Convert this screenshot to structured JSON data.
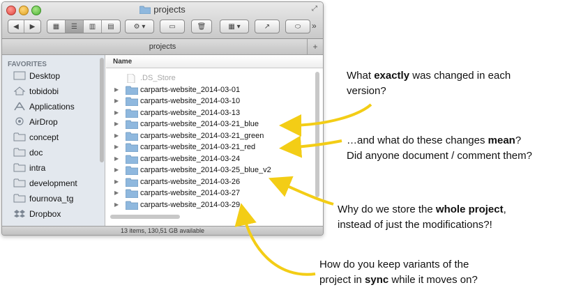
{
  "window": {
    "title": "projects",
    "path_label": "projects",
    "status": "13 items, 130,51 GB available",
    "column_name": "Name"
  },
  "sidebar": {
    "heading": "FAVORITES",
    "items": [
      {
        "label": "Desktop",
        "icon": "desktop-icon"
      },
      {
        "label": "tobidobi",
        "icon": "home-icon"
      },
      {
        "label": "Applications",
        "icon": "applications-icon"
      },
      {
        "label": "AirDrop",
        "icon": "airdrop-icon"
      },
      {
        "label": "concept",
        "icon": "folder-icon"
      },
      {
        "label": "doc",
        "icon": "folder-icon"
      },
      {
        "label": "intra",
        "icon": "folder-icon"
      },
      {
        "label": "development",
        "icon": "folder-icon"
      },
      {
        "label": "fournova_tg",
        "icon": "folder-icon"
      },
      {
        "label": "Dropbox",
        "icon": "dropbox-icon"
      }
    ]
  },
  "files": [
    {
      "name": ".DS_Store",
      "kind": "file"
    },
    {
      "name": "carparts-website_2014-03-01",
      "kind": "folder"
    },
    {
      "name": "carparts-website_2014-03-10",
      "kind": "folder"
    },
    {
      "name": "carparts-website_2014-03-13",
      "kind": "folder"
    },
    {
      "name": "carparts-website_2014-03-21_blue",
      "kind": "folder"
    },
    {
      "name": "carparts-website_2014-03-21_green",
      "kind": "folder"
    },
    {
      "name": "carparts-website_2014-03-21_red",
      "kind": "folder"
    },
    {
      "name": "carparts-website_2014-03-24",
      "kind": "folder"
    },
    {
      "name": "carparts-website_2014-03-25_blue_v2",
      "kind": "folder"
    },
    {
      "name": "carparts-website_2014-03-26",
      "kind": "folder"
    },
    {
      "name": "carparts-website_2014-03-27",
      "kind": "folder"
    },
    {
      "name": "carparts-website_2014-03-29",
      "kind": "folder"
    }
  ],
  "annotations": {
    "a1_pre": "What ",
    "a1_bold": "exactly",
    "a1_post": " was changed in each",
    "a1_line2": "version?",
    "a2_pre": "…and what do these changes ",
    "a2_bold": "mean",
    "a2_post": "?",
    "a2_line2": "Did anyone document / comment them?",
    "a3_pre": "Why do we store the ",
    "a3_bold": "whole project",
    "a3_post": ",",
    "a3_line2": "instead of just the modifications?!",
    "a4_line1": "How do you keep variants of the",
    "a4_pre": "project in ",
    "a4_bold": "sync",
    "a4_post": " while it moves on?"
  },
  "colors": {
    "arrow": "#f3cd16",
    "folder": "#8fb8de",
    "sidebar_bg": "#e3e8ee"
  }
}
